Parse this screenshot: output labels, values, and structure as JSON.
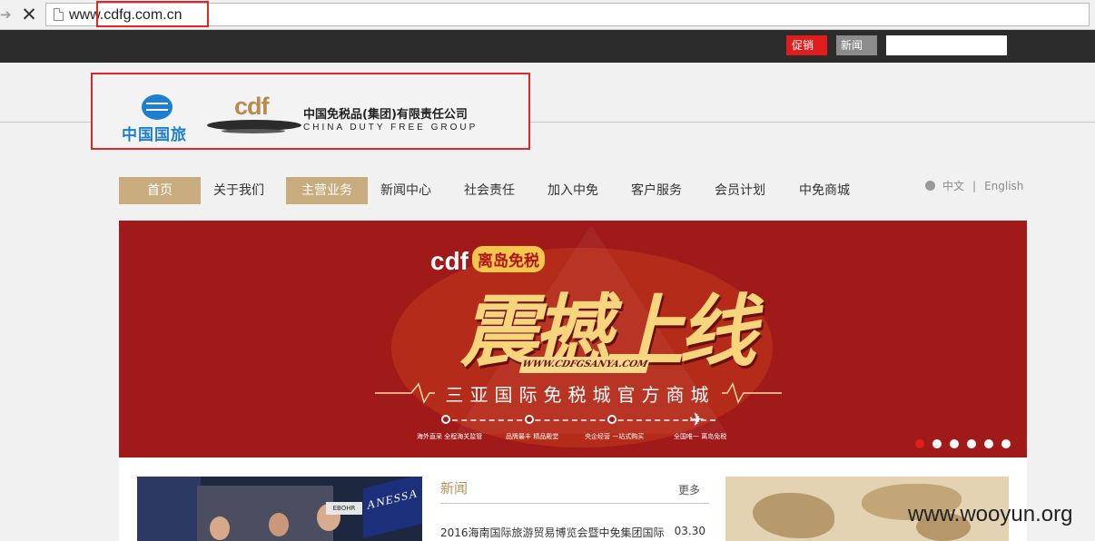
{
  "browser": {
    "url": "www.cdfg.com.cn"
  },
  "topbar": {
    "promo_label": "促销",
    "news_label": "新闻",
    "search_value": ""
  },
  "logo": {
    "cits_name": "中国国旅",
    "cdf_letters": "cdf",
    "company_cn": "中国免税品(集团)有限责任公司",
    "company_en": "CHINA DUTY FREE GROUP"
  },
  "nav": {
    "items": [
      "首页",
      "关于我们",
      "主营业务",
      "新闻中心",
      "社会责任",
      "加入中免",
      "客户服务",
      "会员计划",
      "中免商城"
    ]
  },
  "lang": {
    "cn": "中文",
    "sep": "|",
    "en": "English"
  },
  "banner": {
    "brand": "cdf",
    "brand_tag": "离岛免税",
    "headline": "震撼上线",
    "url": "WWW.CDFGSANYA.COM",
    "subtitle": "三亚国际免税城官方商城",
    "timeline_labels": [
      "海外直采 全程海关监管",
      "品牌最丰 精品殿堂",
      "央企经营 一站式购买",
      "全国唯一 离岛免税"
    ],
    "slide_count": 6,
    "active_slide": 1,
    "background_color": "#a11a1a",
    "accent_color": "#f6d57d"
  },
  "news": {
    "title": "新闻",
    "more": "更多",
    "items": [
      {
        "text": "2016海南国际旅游贸易博览会暨中免集团国际",
        "date": "03.30"
      }
    ]
  },
  "photo": {
    "sign_anessa": "ANESSA",
    "sign_ebohr": "EBOHR"
  },
  "watermark": "www.wooyun.org",
  "colors": {
    "topbar": "#2c2c2c",
    "promo": "#e21c1c",
    "nav_active": "#c9ac7e",
    "highlight_box": "#e0262a"
  }
}
